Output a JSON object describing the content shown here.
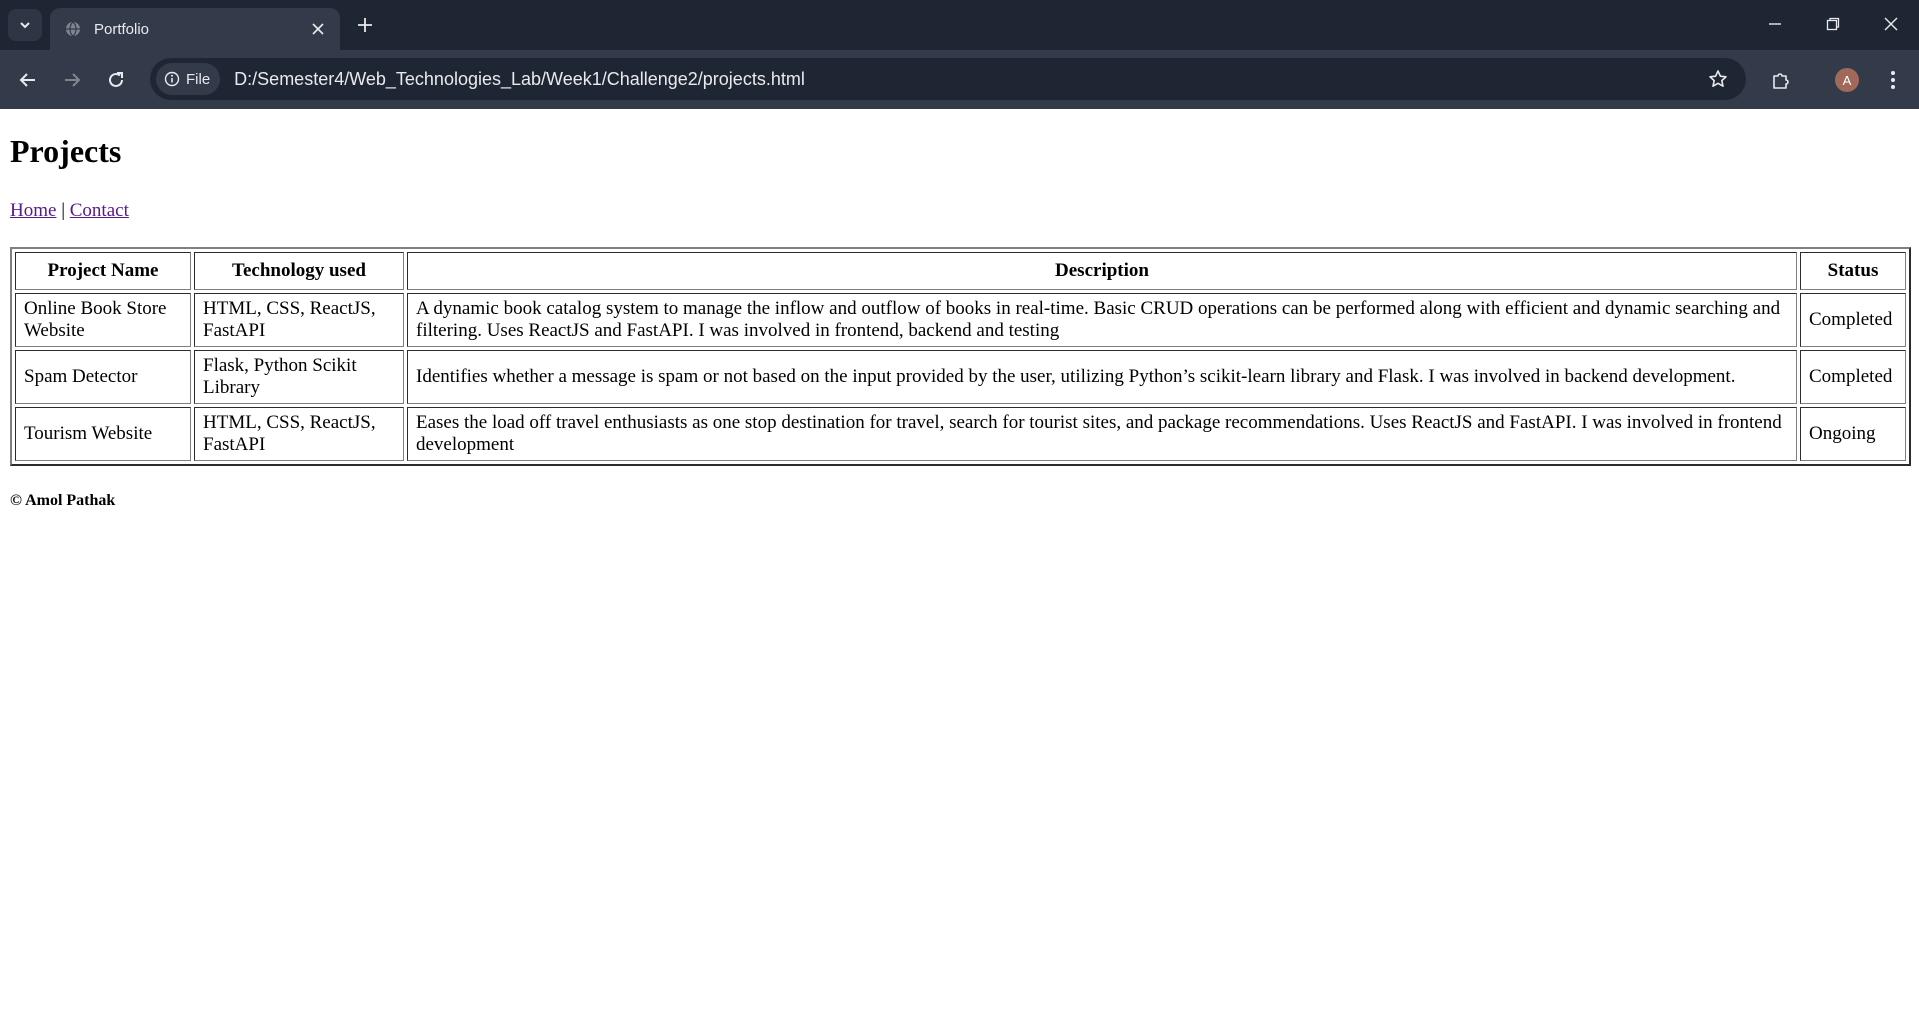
{
  "browser": {
    "tab_title": "Portfolio",
    "chip_label": "File",
    "url": "D:/Semester4/Web_Technologies_Lab/Week1/Challenge2/projects.html",
    "avatar_initial": "A"
  },
  "page": {
    "title": "Projects",
    "nav": {
      "home": "Home",
      "separator": "|",
      "contact": "Contact"
    },
    "table": {
      "headers": {
        "name": "Project Name",
        "tech": "Technology used",
        "description": "Description",
        "status": "Status"
      },
      "rows": [
        {
          "name": "Online Book Store Website",
          "tech": "HTML, CSS, ReactJS, FastAPI",
          "description": "A dynamic book catalog system to manage the inflow and outflow of books in real-time. Basic CRUD operations can be performed along with efficient and dynamic searching and filtering. Uses ReactJS and FastAPI. I was involved in frontend, backend and testing",
          "status": "Completed"
        },
        {
          "name": "Spam Detector",
          "tech": "Flask, Python Scikit Library",
          "description": "Identifies whether a message is spam or not based on the input provided by the user, utilizing Python’s scikit-learn library and Flask. I was involved in backend development.",
          "status": "Completed"
        },
        {
          "name": "Tourism Website",
          "tech": "HTML, CSS, ReactJS, FastAPI",
          "description": "Eases the load off travel enthusiasts as one stop destination for travel, search for tourist sites, and package recommendations. Uses ReactJS and FastAPI. I was involved in frontend development",
          "status": "Ongoing"
        }
      ]
    },
    "footer": "© Amol Pathak"
  },
  "colors": {
    "tabstrip_bg": "#1f2633",
    "toolbar_bg": "#333b4a",
    "visited_link": "#551a8b"
  }
}
